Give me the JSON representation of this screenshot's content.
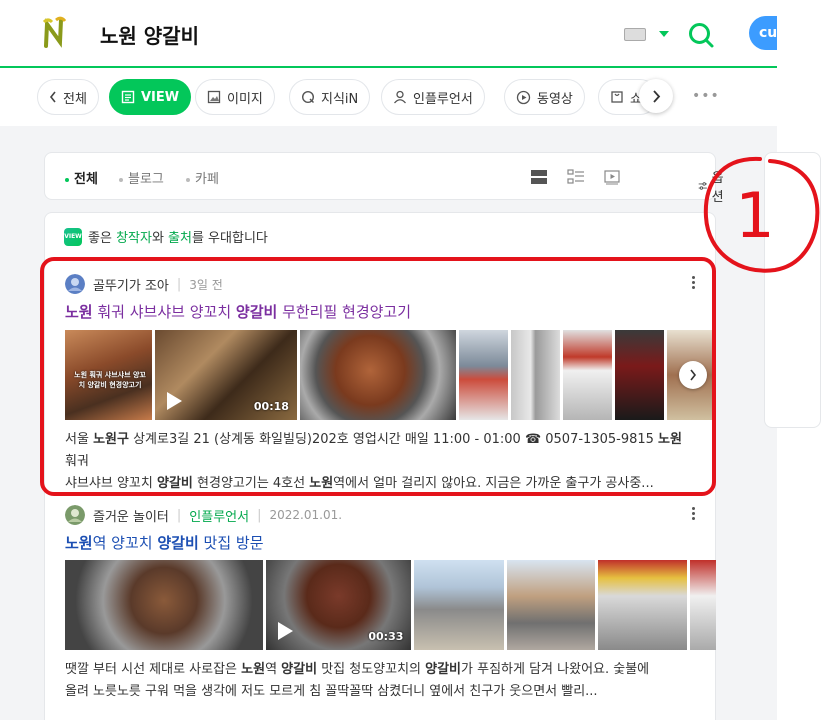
{
  "header": {
    "query": "노원 양갈비",
    "user_button_label": "cu"
  },
  "nav": {
    "tabs": [
      {
        "label": "전체",
        "icon": "chevron-left-icon"
      },
      {
        "label": "VIEW",
        "icon": "document-icon",
        "active": true
      },
      {
        "label": "이미지",
        "icon": "image-icon"
      },
      {
        "label": "지식iN",
        "icon": "q-bubble-icon"
      },
      {
        "label": "인플루언서",
        "icon": "person-icon"
      },
      {
        "label": "동영상",
        "icon": "play-circle-icon"
      },
      {
        "label": "쇼",
        "icon": "bag-icon"
      }
    ],
    "more_label": "•••"
  },
  "filter": {
    "options": [
      "전체",
      "블로그",
      "카페"
    ],
    "settings_label": "옵션"
  },
  "banner": {
    "badge": "VIEW",
    "parts": [
      "좋은 ",
      "창작자",
      "와 ",
      "출처",
      "를 우대합니다"
    ]
  },
  "posts": [
    {
      "author": "골뚜기가 조아",
      "time": "3일 전",
      "title_parts": [
        [
          "노원",
          true
        ],
        [
          " 훠궈 샤브샤브 양꼬치 ",
          false
        ],
        [
          "양갈비",
          true
        ],
        [
          " 무한리필 현경양고기",
          false
        ]
      ],
      "video_duration": "00:18",
      "thumb_caption": "노원 훠궈 샤브샤브 양꼬치 양갈비 현경양고기",
      "excerpt_line1": [
        [
          "서울 ",
          false
        ],
        [
          "노원구",
          true
        ],
        [
          " 상계로3길 21 (상계동 화일빌딩)202호 영업시간 매일 11:00 - 01:00 ☎ 0507-1305-9815 ",
          false
        ],
        [
          "노원",
          true
        ],
        [
          " 훠궈",
          false
        ]
      ],
      "excerpt_line2": [
        [
          "샤브샤브 양꼬치 ",
          false
        ],
        [
          "양갈비",
          true
        ],
        [
          " 현경양고기는 4호선 ",
          false
        ],
        [
          "노원",
          true
        ],
        [
          "역에서 얼마 걸리지 않아요. 지금은 가까운 출구가 공사중...",
          false
        ]
      ]
    },
    {
      "author": "즐거운 놀이터",
      "badge": "인플루언서",
      "time": "2022.01.01.",
      "title_parts": [
        [
          "노원",
          true
        ],
        [
          "역 양꼬치 ",
          false
        ],
        [
          "양갈비",
          true
        ],
        [
          " 맛집 방문",
          false
        ]
      ],
      "video_duration": "00:33",
      "excerpt_line1": [
        [
          "땟깔 부터 시선 제대로 사로잡은 ",
          false
        ],
        [
          "노원",
          true
        ],
        [
          "역 ",
          false
        ],
        [
          "양갈비",
          true
        ],
        [
          " 맛집 청도양꼬치의 ",
          false
        ],
        [
          "양갈비",
          true
        ],
        [
          "가 푸짐하게 담겨 나왔어요. 숯불에",
          false
        ]
      ],
      "excerpt_line2": [
        [
          "올려 노릇노릇 구워 먹을 생각에 저도 모르게 침 꼴딱꼴딱 삼켰더니 옆에서 친구가 웃으면서 빨리...",
          false
        ]
      ]
    }
  ],
  "annotation": {
    "number": "1"
  },
  "colors": {
    "accent": "#03c75a",
    "annotation": "#e4131b",
    "title_visited": "#7b2fa0",
    "title_link": "#1c4fb3"
  }
}
